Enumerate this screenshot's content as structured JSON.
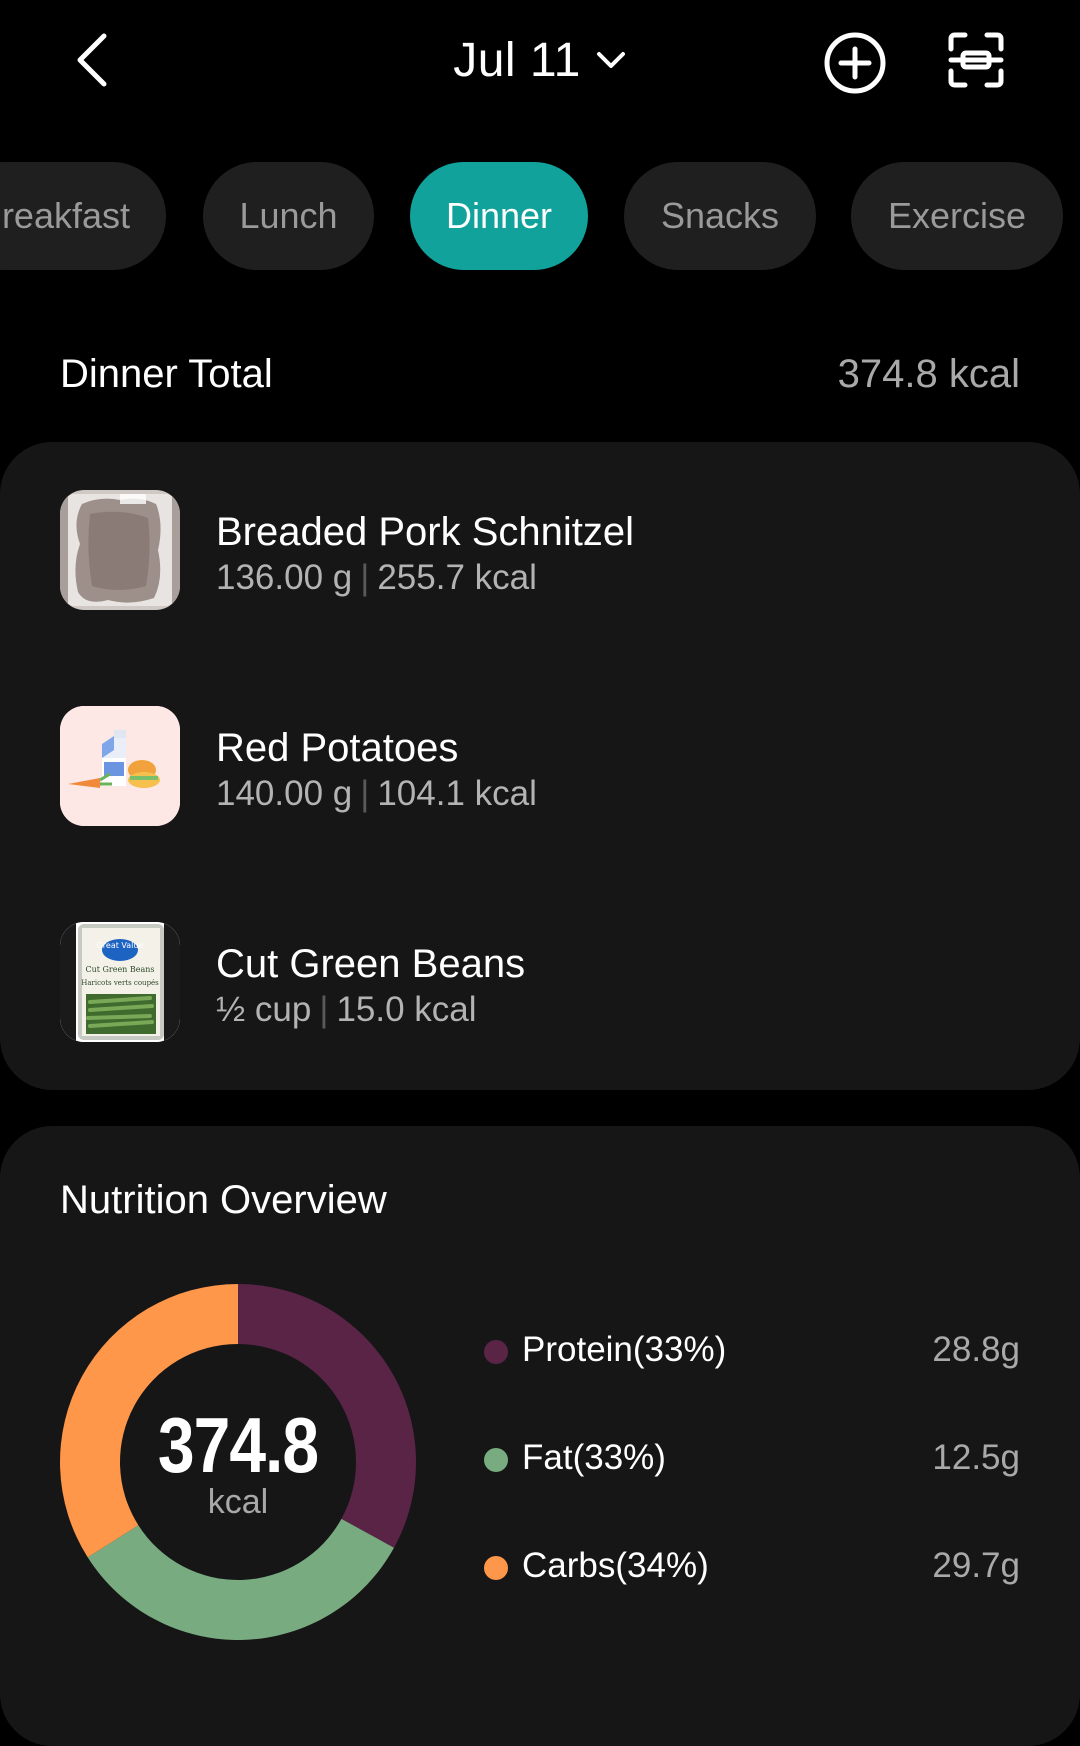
{
  "header": {
    "date": "Jul 11"
  },
  "tabs": [
    {
      "label": "Breakfast",
      "visible_text": "reakfast",
      "active": false
    },
    {
      "label": "Lunch",
      "active": false
    },
    {
      "label": "Dinner",
      "active": true
    },
    {
      "label": "Snacks",
      "active": false
    },
    {
      "label": "Exercise",
      "active": false
    }
  ],
  "total": {
    "label": "Dinner Total",
    "value": "374.8 kcal"
  },
  "foods": [
    {
      "name": "Breaded Pork Schnitzel",
      "amount": "136.00 g",
      "kcal": "255.7 kcal",
      "icon": "pork-schnitzel-photo"
    },
    {
      "name": "Red Potatoes",
      "amount": "140.00 g",
      "kcal": "104.1 kcal",
      "icon": "generic-food-icon"
    },
    {
      "name": "Cut Green Beans",
      "amount": "½ cup",
      "kcal": "15.0 kcal",
      "icon": "green-beans-can-photo",
      "can_text": [
        "Great Value",
        "Cut Green Beans",
        "Haricots verts coupés"
      ]
    }
  ],
  "nutrition": {
    "title": "Nutrition Overview",
    "center_value": "374.8",
    "center_unit": "kcal",
    "macros": [
      {
        "label": "Protein(33%)",
        "value": "28.8g",
        "percent": 33,
        "color": "#5a2447"
      },
      {
        "label": "Fat(33%)",
        "value": "12.5g",
        "percent": 33,
        "color": "#78ab80"
      },
      {
        "label": "Carbs(34%)",
        "value": "29.7g",
        "percent": 34,
        "color": "#ff974a"
      }
    ]
  },
  "colors": {
    "accent": "#11a29b",
    "background": "#000000",
    "card": "#161616"
  }
}
